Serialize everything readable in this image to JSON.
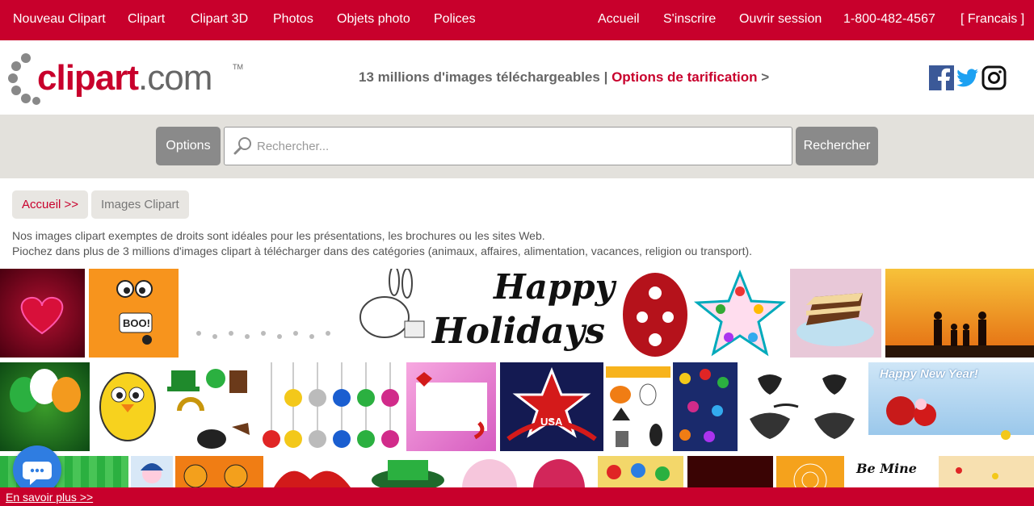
{
  "topnav": {
    "left": [
      "Nouveau Clipart",
      "Clipart",
      "Clipart 3D",
      "Photos",
      "Objets photo",
      "Polices"
    ],
    "right": [
      "Accueil",
      "S'inscrire",
      "Ouvrir session",
      "1-800-482-4567",
      "[ Francais ]"
    ]
  },
  "header": {
    "logo_main": "clipart",
    "logo_suffix": ".com",
    "logo_tm": "TM",
    "tagline": "13 millions d'images téléchargeables",
    "separator": "|",
    "pricing_link": "Options de tarification",
    "pricing_arrow": ">",
    "social": [
      "facebook-icon",
      "twitter-icon",
      "instagram-icon"
    ]
  },
  "search": {
    "options_label": "Options",
    "placeholder": "Rechercher...",
    "button_label": "Rechercher"
  },
  "breadcrumb": {
    "home": "Accueil >>",
    "current": "Images Clipart"
  },
  "description": {
    "line1": "Nos images clipart exemptes de droits sont idéales pour les présentations, les brochures ou les sites Web.",
    "line2": "Piochez dans plus de 3 millions d'images clipart à télécharger dans des catégories (animaux, affaires, alimentation, vacances, religion ou transport)."
  },
  "tiles": {
    "boo": "BOO!",
    "happy": "Happy",
    "holidays": "Holidays",
    "usa": "USA",
    "newyear": "Happy New Year!",
    "bemine": "Be Mine"
  },
  "footer": {
    "learn_more": "En savoir plus >>"
  },
  "colors": {
    "brand_red": "#c8002c",
    "button_gray": "#8a8a8a",
    "band_gray": "#e3e1dc",
    "chat_blue": "#2f7de1"
  }
}
